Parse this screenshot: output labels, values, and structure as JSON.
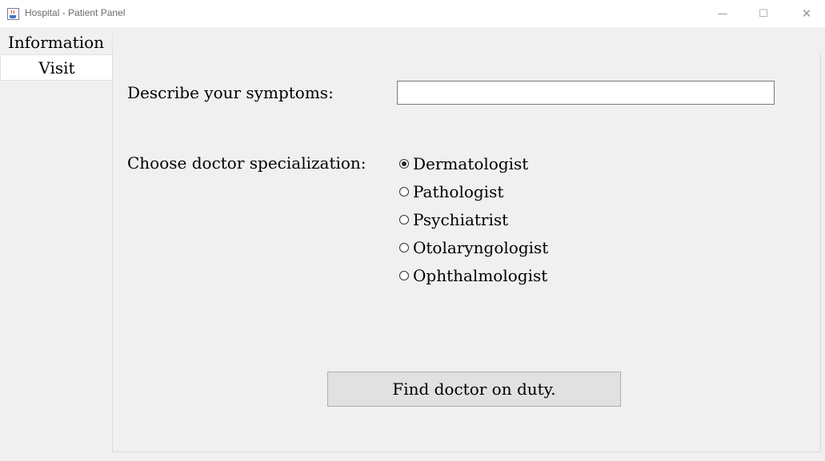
{
  "window": {
    "title": "Hospital - Patient Panel",
    "minimize_glyph": "—",
    "maximize_glyph": "☐",
    "close_glyph": "✕"
  },
  "tabs": [
    {
      "label": "Information",
      "selected": false
    },
    {
      "label": "Visit",
      "selected": true
    }
  ],
  "visit_form": {
    "symptoms_label": "Describe your symptoms:",
    "symptoms_value": "",
    "specialization_label": "Choose doctor specialization:",
    "specializations": [
      {
        "label": "Dermatologist",
        "checked": true
      },
      {
        "label": "Pathologist",
        "checked": false
      },
      {
        "label": "Psychiatrist",
        "checked": false
      },
      {
        "label": "Otolaryngologist",
        "checked": false
      },
      {
        "label": "Ophthalmologist",
        "checked": false
      }
    ],
    "find_button_label": "Find doctor on duty."
  },
  "colors": {
    "window_bg": "#f0f0f0",
    "titlebar_bg": "#ffffff",
    "button_bg": "#e1e1e1"
  },
  "icons": {
    "app": "java-cup-icon"
  }
}
